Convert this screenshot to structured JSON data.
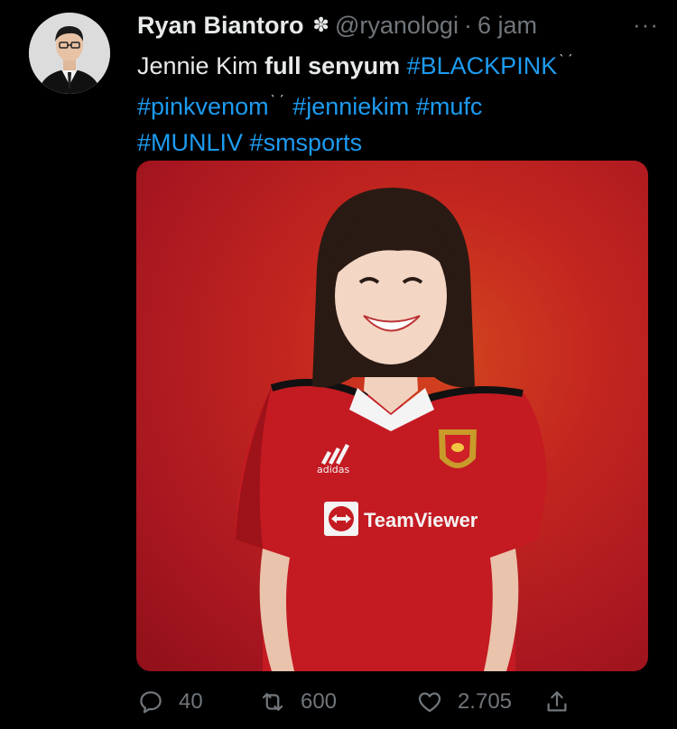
{
  "tweet": {
    "display_name": "Ryan Biantoro",
    "badge_glyph": "✽",
    "handle": "@ryanologi",
    "separator": "·",
    "time": "6 jam",
    "more": "···",
    "text": {
      "part1": "Jennie Kim ",
      "bold": "full senyum",
      "tag_blackpink": "#BLACKPINK",
      "tag_pinkvenom": "#pinkvenom",
      "tag_jenniekim": "#jenniekim",
      "tag_mufc": "#mufc",
      "tag_munliv": "#MUNLIV",
      "tag_smsports": "#smsports",
      "spark": "ˋ ˊ"
    },
    "media": {
      "sponsor": "TeamViewer",
      "kit_brand": "adidas",
      "background_color": "#c3261f"
    },
    "actions": {
      "replies": "40",
      "retweets": "600",
      "likes": "2.705"
    }
  },
  "colors": {
    "background": "#000000",
    "text": "#e7e9ea",
    "muted": "#71767b",
    "link": "#1d9bf0"
  }
}
